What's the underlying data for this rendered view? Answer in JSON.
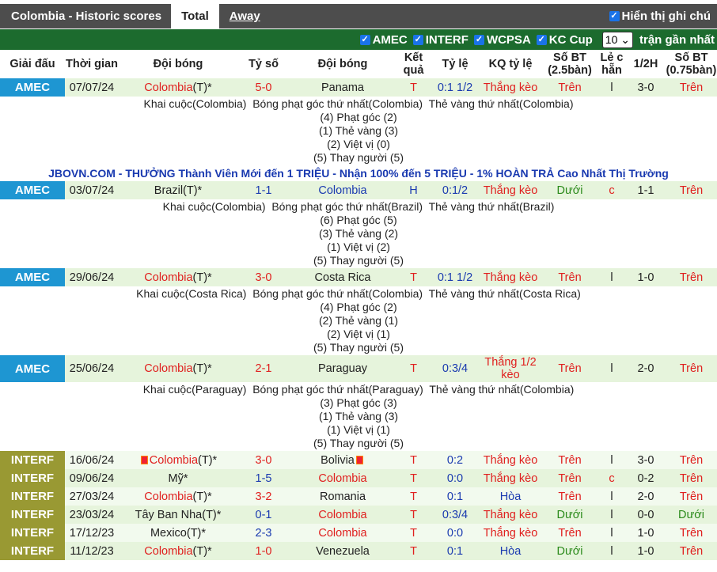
{
  "header": {
    "title": "Colombia - Historic scores",
    "tabs": [
      "Total",
      "Away"
    ],
    "show_notes": "Hiển thị ghi chú"
  },
  "filters": {
    "items": [
      "AMEC",
      "INTERF",
      "WCPSA",
      "KC Cup"
    ],
    "count": "10",
    "count_suffix": "trận gần nhất"
  },
  "columns": [
    "Giải đấu",
    "Thời gian",
    "Đội bóng",
    "Tỷ số",
    "Đội bóng",
    "Kết quả",
    "Tỷ lệ",
    "KQ tỷ lệ",
    "Số BT (2.5bàn)",
    "Lẻ c hẵn",
    "1/2H",
    "Số BT (0.75bàn)"
  ],
  "ad": "JBOVN.COM - THƯỞNG Thành Viên Mới đến 1 TRIỆU - Nhận 100% đến 5 TRIỆU - 1% HOÀN TRẢ Cao Nhất Thị Trường",
  "colors": {
    "amec": "#1e96d2",
    "interf": "#999933",
    "filterbar": "#1c6b2e",
    "topbar": "#4d4d4d"
  },
  "matches": [
    {
      "comp": "AMEC",
      "date": "07/07/24",
      "home": "Colombia",
      "home_suffix": "(T)*",
      "score": "5-0",
      "away": "Panama",
      "result": "T",
      "odds": "0:1 1/2",
      "odds_result": "Thắng kèo",
      "ou": "Trên",
      "oe": "l",
      "ht": "3-0",
      "ou2": "Trên",
      "notes": [
        "Khai cuộc(Colombia)  Bóng phạt góc thứ nhất(Colombia)  Thẻ vàng thứ nhất(Colombia)",
        "(4) Phạt góc (2)",
        "(1) Thẻ vàng (3)",
        "(2) Việt vị (0)",
        "(5) Thay người (5)"
      ]
    },
    {
      "comp": "AMEC",
      "date": "03/07/24",
      "home": "Brazil",
      "home_suffix": "(T)*",
      "score": "1-1",
      "away": "Colombia",
      "result": "H",
      "odds": "0:1/2",
      "odds_result": "Thắng kèo",
      "ou": "Dưới",
      "oe": "c",
      "ht": "1-1",
      "ou2": "Trên",
      "notes": [
        "Khai cuộc(Colombia)  Bóng phạt góc thứ nhất(Brazil)  Thẻ vàng thứ nhất(Brazil)",
        "(6) Phạt góc (5)",
        "(3) Thẻ vàng (2)",
        "(1) Việt vị (2)",
        "(5) Thay người (5)"
      ]
    },
    {
      "comp": "AMEC",
      "date": "29/06/24",
      "home": "Colombia",
      "home_suffix": "(T)*",
      "score": "3-0",
      "away": "Costa Rica",
      "result": "T",
      "odds": "0:1 1/2",
      "odds_result": "Thắng kèo",
      "ou": "Trên",
      "oe": "l",
      "ht": "1-0",
      "ou2": "Trên",
      "notes": [
        "Khai cuộc(Costa Rica)  Bóng phạt góc thứ nhất(Colombia)  Thẻ vàng thứ nhất(Costa Rica)",
        "(4) Phạt góc (2)",
        "(2) Thẻ vàng (1)",
        "(2) Việt vị (1)",
        "(5) Thay người (5)"
      ]
    },
    {
      "comp": "AMEC",
      "date": "25/06/24",
      "home": "Colombia",
      "home_suffix": "(T)*",
      "score": "2-1",
      "away": "Paraguay",
      "result": "T",
      "odds": "0:3/4",
      "odds_result": "Thắng 1/2 kèo",
      "ou": "Trên",
      "oe": "l",
      "ht": "2-0",
      "ou2": "Trên",
      "notes": [
        "Khai cuộc(Paraguay)  Bóng phạt góc thứ nhất(Paraguay)  Thẻ vàng thứ nhất(Colombia)",
        "(3) Phạt góc (3)",
        "(1) Thẻ vàng (3)",
        "(1) Việt vị (1)",
        "(5) Thay người (5)"
      ]
    },
    {
      "comp": "INTERF",
      "date": "16/06/24",
      "home": "Colombia",
      "home_suffix": "(T)*",
      "score": "3-0",
      "away": "Bolivia",
      "result": "T",
      "odds": "0:2",
      "odds_result": "Thắng kèo",
      "ou": "Trên",
      "oe": "l",
      "ht": "3-0",
      "ou2": "Trên",
      "flags": true
    },
    {
      "comp": "INTERF",
      "date": "09/06/24",
      "home": "Mỹ",
      "home_suffix": "*",
      "score": "1-5",
      "away": "Colombia",
      "result": "T",
      "odds": "0:0",
      "odds_result": "Thắng kèo",
      "ou": "Trên",
      "oe": "c",
      "ht": "0-2",
      "ou2": "Trên"
    },
    {
      "comp": "INTERF",
      "date": "27/03/24",
      "home": "Colombia",
      "home_suffix": "(T)*",
      "score": "3-2",
      "away": "Romania",
      "result": "T",
      "odds": "0:1",
      "odds_result": "Hòa",
      "ou": "Trên",
      "oe": "l",
      "ht": "2-0",
      "ou2": "Trên"
    },
    {
      "comp": "INTERF",
      "date": "23/03/24",
      "home": "Tây Ban Nha",
      "home_suffix": "(T)*",
      "score": "0-1",
      "away": "Colombia",
      "result": "T",
      "odds": "0:3/4",
      "odds_result": "Thắng kèo",
      "ou": "Dưới",
      "oe": "l",
      "ht": "0-0",
      "ou2": "Dưới"
    },
    {
      "comp": "INTERF",
      "date": "17/12/23",
      "home": "Mexico",
      "home_suffix": "(T)*",
      "score": "2-3",
      "away": "Colombia",
      "result": "T",
      "odds": "0:0",
      "odds_result": "Thắng kèo",
      "ou": "Trên",
      "oe": "l",
      "ht": "1-0",
      "ou2": "Trên"
    },
    {
      "comp": "INTERF",
      "date": "11/12/23",
      "home": "Colombia",
      "home_suffix": "(T)*",
      "score": "1-0",
      "away": "Venezuela",
      "result": "T",
      "odds": "0:1",
      "odds_result": "Hòa",
      "ou": "Dưới",
      "oe": "l",
      "ht": "1-0",
      "ou2": "Trên"
    }
  ]
}
